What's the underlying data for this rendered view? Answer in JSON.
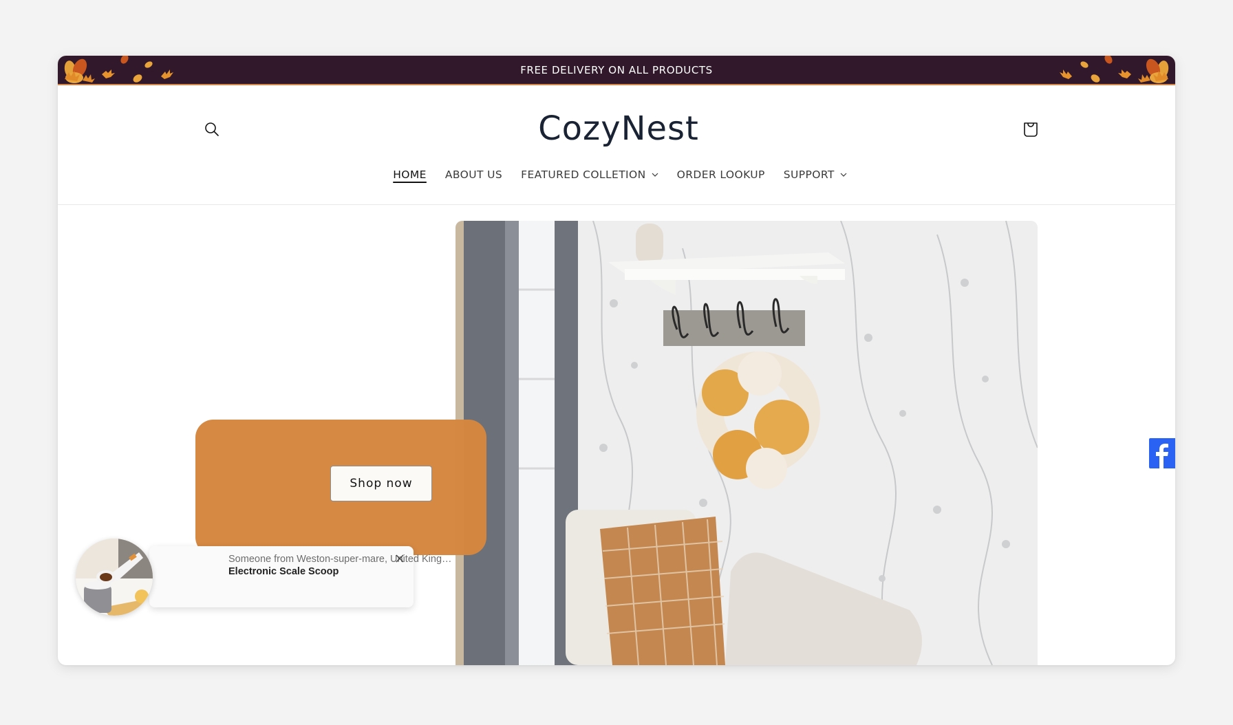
{
  "announcement": {
    "text": "FREE DELIVERY ON ALL PRODUCTS",
    "background": "#31192b",
    "accent_line": "#d4874a"
  },
  "header": {
    "logo_text": "CozyNest",
    "search_icon": "search-icon",
    "cart_icon": "shopping-bag-icon"
  },
  "nav": {
    "items": [
      {
        "label": "HOME",
        "active": true,
        "has_dropdown": false
      },
      {
        "label": "ABOUT US",
        "active": false,
        "has_dropdown": false
      },
      {
        "label": "FEATURED COLLETION",
        "active": false,
        "has_dropdown": true
      },
      {
        "label": "ORDER LOOKUP",
        "active": false,
        "has_dropdown": false
      },
      {
        "label": "SUPPORT",
        "active": false,
        "has_dropdown": true
      }
    ]
  },
  "hero": {
    "image_description": "Entryway with floral wallpaper, white shelf, coat hooks, hydrangea wreath and cushions",
    "promo_color": "#d4873f",
    "cta_label": "Shop now"
  },
  "social": {
    "facebook_icon": "facebook-icon",
    "facebook_color": "#2a62f3"
  },
  "sales_notification": {
    "message": "Someone from Weston-super-mare, United King…",
    "product": "Electronic Scale Scoop",
    "close_icon": "close-icon"
  }
}
